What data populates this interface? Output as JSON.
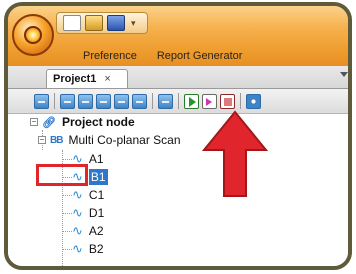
{
  "menu": {
    "items": [
      "Preference",
      "Report Generator"
    ]
  },
  "tab": {
    "label": "Project1",
    "close": "×"
  },
  "toolbar": {
    "buttons": [
      "tool-1",
      "tool-2",
      "tool-3",
      "tool-4",
      "tool-5",
      "tool-6",
      "tool-7",
      "run",
      "step",
      "stop",
      "settings"
    ]
  },
  "tree": {
    "root": "Project node",
    "scan": "Multi Co-planar Scan",
    "items": [
      "A1",
      "B1",
      "C1",
      "D1",
      "A2",
      "B2"
    ],
    "selected_index": 1
  },
  "colors": {
    "ribbon": "#ef9f32",
    "highlight_box": "#e0262c",
    "arrow": "#e0262c",
    "selection": "#2f78c9"
  }
}
